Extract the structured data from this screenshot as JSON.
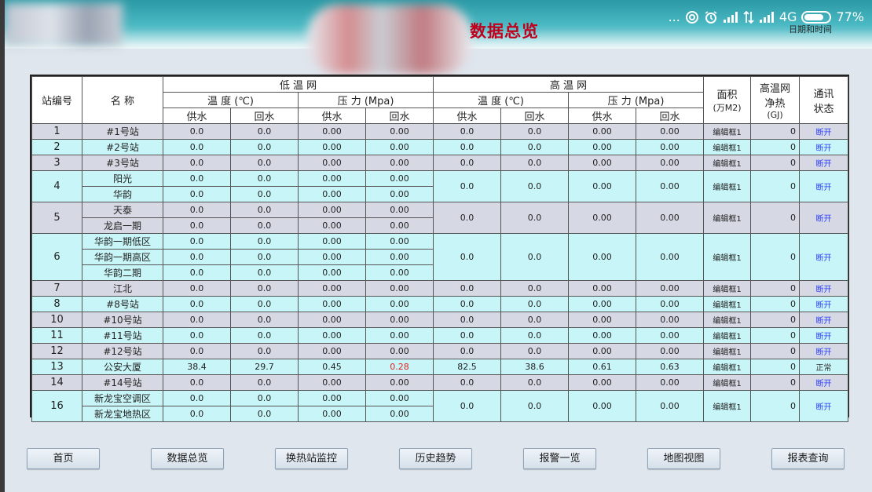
{
  "header": {
    "title": "数据总览",
    "datetime": "日期和时间",
    "status": {
      "more": "...",
      "network": "4G",
      "battery": "77%"
    }
  },
  "table": {
    "headers": {
      "station_id": "站编号",
      "name": "名 称",
      "low_net": "低 温 网",
      "high_net": "高 温 网",
      "temp": "温 度 (℃)",
      "pressure": "压 力 (Mpa)",
      "supply": "供水",
      "return": "回水",
      "area_line1": "面积",
      "area_line2": "(万M2)",
      "heat_line1": "高温网",
      "heat_line2": "净热",
      "heat_line3": "(GJ)",
      "comm_line1": "通讯",
      "comm_line2": "状态"
    },
    "stations": [
      {
        "id": "1",
        "subs": [
          {
            "name": "#1号站",
            "lt_s": "0.0",
            "lt_r": "0.0",
            "lp_s": "0.00",
            "lp_r": "0.00"
          }
        ],
        "ht_s": "0.0",
        "ht_r": "0.0",
        "hp_s": "0.00",
        "hp_r": "0.00",
        "area": "编辑框1",
        "heat": "0",
        "comm": "断开"
      },
      {
        "id": "2",
        "subs": [
          {
            "name": "#2号站",
            "lt_s": "0.0",
            "lt_r": "0.0",
            "lp_s": "0.00",
            "lp_r": "0.00"
          }
        ],
        "ht_s": "0.0",
        "ht_r": "0.0",
        "hp_s": "0.00",
        "hp_r": "0.00",
        "area": "编辑框1",
        "heat": "0",
        "comm": "断开"
      },
      {
        "id": "3",
        "subs": [
          {
            "name": "#3号站",
            "lt_s": "0.0",
            "lt_r": "0.0",
            "lp_s": "0.00",
            "lp_r": "0.00"
          }
        ],
        "ht_s": "0.0",
        "ht_r": "0.0",
        "hp_s": "0.00",
        "hp_r": "0.00",
        "area": "编辑框1",
        "heat": "0",
        "comm": "断开"
      },
      {
        "id": "4",
        "subs": [
          {
            "name": "阳光",
            "lt_s": "0.0",
            "lt_r": "0.0",
            "lp_s": "0.00",
            "lp_r": "0.00"
          },
          {
            "name": "华韵",
            "lt_s": "0.0",
            "lt_r": "0.0",
            "lp_s": "0.00",
            "lp_r": "0.00"
          }
        ],
        "ht_s": "0.0",
        "ht_r": "0.0",
        "hp_s": "0.00",
        "hp_r": "0.00",
        "area": "编辑框1",
        "heat": "0",
        "comm": "断开"
      },
      {
        "id": "5",
        "subs": [
          {
            "name": "天泰",
            "lt_s": "0.0",
            "lt_r": "0.0",
            "lp_s": "0.00",
            "lp_r": "0.00"
          },
          {
            "name": "龙启一期",
            "lt_s": "0.0",
            "lt_r": "0.0",
            "lp_s": "0.00",
            "lp_r": "0.00"
          }
        ],
        "ht_s": "0.0",
        "ht_r": "0.0",
        "hp_s": "0.00",
        "hp_r": "0.00",
        "area": "编辑框1",
        "heat": "0",
        "comm": "断开"
      },
      {
        "id": "6",
        "subs": [
          {
            "name": "华韵一期低区",
            "lt_s": "0.0",
            "lt_r": "0.0",
            "lp_s": "0.00",
            "lp_r": "0.00"
          },
          {
            "name": "华韵一期高区",
            "lt_s": "0.0",
            "lt_r": "0.0",
            "lp_s": "0.00",
            "lp_r": "0.00"
          },
          {
            "name": "华韵二期",
            "lt_s": "0.0",
            "lt_r": "0.0",
            "lp_s": "0.00",
            "lp_r": "0.00"
          }
        ],
        "ht_s": "0.0",
        "ht_r": "0.0",
        "hp_s": "0.00",
        "hp_r": "0.00",
        "area": "编辑框1",
        "heat": "0",
        "comm": "断开"
      },
      {
        "id": "7",
        "subs": [
          {
            "name": "江北",
            "lt_s": "0.0",
            "lt_r": "0.0",
            "lp_s": "0.00",
            "lp_r": "0.00"
          }
        ],
        "ht_s": "0.0",
        "ht_r": "0.0",
        "hp_s": "0.00",
        "hp_r": "0.00",
        "area": "编辑框1",
        "heat": "0",
        "comm": "断开"
      },
      {
        "id": "8",
        "subs": [
          {
            "name": "#8号站",
            "lt_s": "0.0",
            "lt_r": "0.0",
            "lp_s": "0.00",
            "lp_r": "0.00"
          }
        ],
        "ht_s": "0.0",
        "ht_r": "0.0",
        "hp_s": "0.00",
        "hp_r": "0.00",
        "area": "编辑框1",
        "heat": "0",
        "comm": "断开"
      },
      {
        "id": "10",
        "subs": [
          {
            "name": "#10号站",
            "lt_s": "0.0",
            "lt_r": "0.0",
            "lp_s": "0.00",
            "lp_r": "0.00"
          }
        ],
        "ht_s": "0.0",
        "ht_r": "0.0",
        "hp_s": "0.00",
        "hp_r": "0.00",
        "area": "编辑框1",
        "heat": "0",
        "comm": "断开"
      },
      {
        "id": "11",
        "subs": [
          {
            "name": "#11号站",
            "lt_s": "0.0",
            "lt_r": "0.0",
            "lp_s": "0.00",
            "lp_r": "0.00"
          }
        ],
        "ht_s": "0.0",
        "ht_r": "0.0",
        "hp_s": "0.00",
        "hp_r": "0.00",
        "area": "编辑框1",
        "heat": "0",
        "comm": "断开"
      },
      {
        "id": "12",
        "subs": [
          {
            "name": "#12号站",
            "lt_s": "0.0",
            "lt_r": "0.0",
            "lp_s": "0.00",
            "lp_r": "0.00"
          }
        ],
        "ht_s": "0.0",
        "ht_r": "0.0",
        "hp_s": "0.00",
        "hp_r": "0.00",
        "area": "编辑框1",
        "heat": "0",
        "comm": "断开"
      },
      {
        "id": "13",
        "subs": [
          {
            "name": "公安大厦",
            "lt_s": "38.4",
            "lt_r": "29.7",
            "lp_s": "0.45",
            "lp_r": "0.28",
            "lp_r_alarm": true
          }
        ],
        "ht_s": "82.5",
        "ht_r": "38.6",
        "hp_s": "0.61",
        "hp_r": "0.63",
        "area": "编辑框1",
        "heat": "0",
        "comm": "正常",
        "comm_ok": true
      },
      {
        "id": "14",
        "subs": [
          {
            "name": "#14号站",
            "lt_s": "0.0",
            "lt_r": "0.0",
            "lp_s": "0.00",
            "lp_r": "0.00"
          }
        ],
        "ht_s": "0.0",
        "ht_r": "0.0",
        "hp_s": "0.00",
        "hp_r": "0.00",
        "area": "编辑框1",
        "heat": "0",
        "comm": "断开"
      },
      {
        "id": "16",
        "subs": [
          {
            "name": "新龙宝空调区",
            "lt_s": "0.0",
            "lt_r": "0.0",
            "lp_s": "0.00",
            "lp_r": "0.00"
          },
          {
            "name": "新龙宝地热区",
            "lt_s": "0.0",
            "lt_r": "0.0",
            "lp_s": "0.00",
            "lp_r": "0.00"
          }
        ],
        "ht_s": "0.0",
        "ht_r": "0.0",
        "hp_s": "0.00",
        "hp_r": "0.00",
        "area": "编辑框1",
        "heat": "0",
        "comm": "断开"
      }
    ]
  },
  "nav": [
    {
      "label": "首页",
      "name": "nav-home-button"
    },
    {
      "label": "数据总览",
      "name": "nav-data-overview-button"
    },
    {
      "label": "换热站监控",
      "name": "nav-station-monitor-button"
    },
    {
      "label": "历史趋势",
      "name": "nav-history-trend-button"
    },
    {
      "label": "报警一览",
      "name": "nav-alarm-list-button"
    },
    {
      "label": "地图视图",
      "name": "nav-map-view-button"
    },
    {
      "label": "报表查询",
      "name": "nav-report-query-button"
    }
  ],
  "colors": {
    "title": "#c0001c",
    "alarm": "#e02020",
    "comm_disconnected": "#2a3cff",
    "row_gray": "#d6d9e4",
    "row_cyan": "#c8f6f8"
  }
}
